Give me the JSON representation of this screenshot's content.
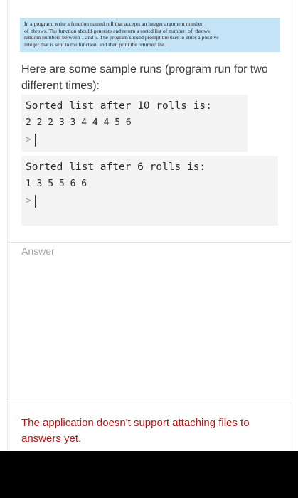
{
  "question": {
    "text_lines": [
      "In a program, write a function named roll that accepts an integer argument number_",
      "of_throws. The function should generate and return a sorted list of number_of_throws",
      "random numbers between 1 and 6. The program should prompt the user to enter a positive",
      "integer that is sent to the function, and then print the returned list."
    ]
  },
  "intro_text": "Here are some sample runs (program run for two different times):",
  "sample_runs": [
    {
      "heading": "Sorted list after 10 rolls is:",
      "numbers": "2 2 2 3 3 4 4 4 5 6",
      "prompt": ">"
    },
    {
      "heading": "Sorted list after 6 rolls is:",
      "numbers": "1 3 5 5 6 6",
      "prompt": ">"
    }
  ],
  "answer": {
    "placeholder": "Answer"
  },
  "notice": "The application doesn't support attaching files to answers yet."
}
